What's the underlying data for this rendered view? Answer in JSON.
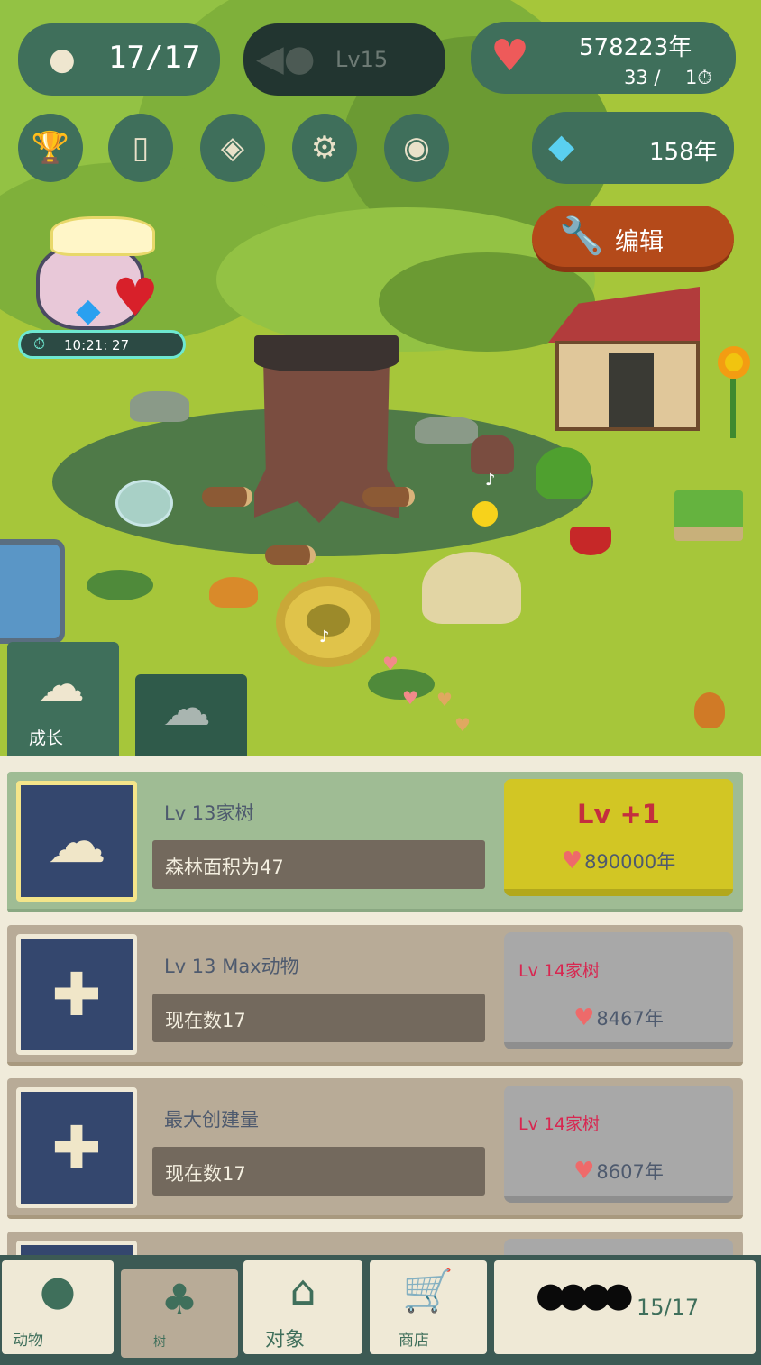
{
  "hud": {
    "animal_count": "17/17",
    "level": "Lv15",
    "hearts_total": "578223年",
    "hearts_rate": "33 /",
    "hearts_rate_unit": "1",
    "gems": "158年",
    "edit_label": "编辑",
    "gift_timer": "10:21: 27"
  },
  "side_tabs": {
    "grow_label": "成长"
  },
  "upgrades": [
    {
      "title": "Lv 13家树",
      "info": "森林面积为47",
      "action_label": "Lv +1",
      "cost": "890000年",
      "active": true
    },
    {
      "title": "Lv 13 Max动物",
      "info": "现在数17",
      "action_label": "Lv 14家树",
      "cost": "8467年",
      "active": false
    },
    {
      "title": "最大创建量",
      "info": "现在数17",
      "action_label": "Lv 14家树",
      "cost": "8607年",
      "active": false
    }
  ],
  "nav": {
    "animals": "动物",
    "trees": "树",
    "objects": "对象",
    "shop": "商店",
    "caterpillar_count": "15/17"
  },
  "colors": {
    "hud_green": "#3f6f5b",
    "edit_orange": "#b44a1a",
    "heart_red": "#ee5a5a",
    "active_yellow": "#d2c624"
  },
  "icons": [
    "bird-icon",
    "fish-icon",
    "heart-icon",
    "diamond-icon",
    "trophy-icon",
    "cards-icon",
    "map-icon",
    "gear-icon",
    "camera-icon",
    "wrench-icon",
    "stopwatch-icon",
    "tree-icon",
    "shop-cart-icon",
    "house-icon"
  ]
}
